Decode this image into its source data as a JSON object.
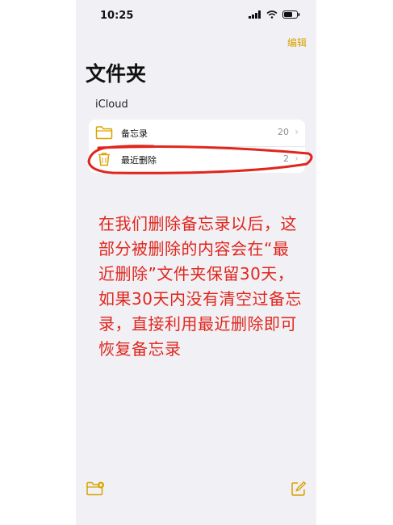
{
  "status_bar": {
    "time": "10:25"
  },
  "toolbar": {
    "edit_label": "编辑"
  },
  "header": {
    "title": "文件夹"
  },
  "section": {
    "title": "iCloud"
  },
  "folders": [
    {
      "name": "备忘录",
      "count": "20",
      "chevron": "›",
      "icon": "folder-icon"
    },
    {
      "name": "最近删除",
      "count": "2",
      "chevron": "›",
      "icon": "trash-icon"
    }
  ],
  "annotation": {
    "text": "在我们删除备忘录以后，这部分被删除的内容会在“最近删除”文件夹保留30天，如果30天内没有清空过备忘录，直接利用最近删除即可恢复备忘录"
  },
  "colors": {
    "accent": "#d9a300",
    "annotation": "#e0261c",
    "background": "#f1f0f5"
  },
  "bottom_bar": {
    "left_icon": "new-folder-icon",
    "right_icon": "compose-icon"
  }
}
